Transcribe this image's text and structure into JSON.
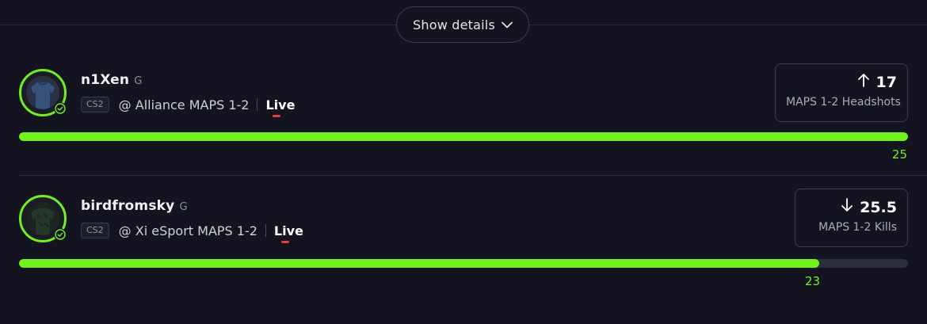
{
  "header": {
    "show_details_label": "Show details"
  },
  "picks": [
    {
      "player_name": "n1Xen",
      "position": "G",
      "game": "CS2",
      "matchup": "@ Alliance MAPS 1-2",
      "status": "Live",
      "direction": "up",
      "line_value": "17",
      "stat_label": "MAPS 1-2 Headshots",
      "current_value": "25",
      "progress_fraction": 1.0,
      "avatar_color": "#2e3d5c"
    },
    {
      "player_name": "birdfromsky",
      "position": "G",
      "game": "CS2",
      "matchup": "@ Xi eSport MAPS 1-2",
      "status": "Live",
      "direction": "down",
      "line_value": "25.5",
      "stat_label": "MAPS 1-2 Kills",
      "current_value": "23",
      "progress_fraction": 0.9,
      "avatar_color": "#1f2a24"
    }
  ],
  "colors": {
    "accent": "#6ff21c",
    "live_underline": "#e8413d",
    "background": "#13141f"
  },
  "icons": {
    "show_details": "chevron-down-icon",
    "verified": "check-circle-icon",
    "over": "arrow-up-icon",
    "under": "arrow-down-icon"
  }
}
